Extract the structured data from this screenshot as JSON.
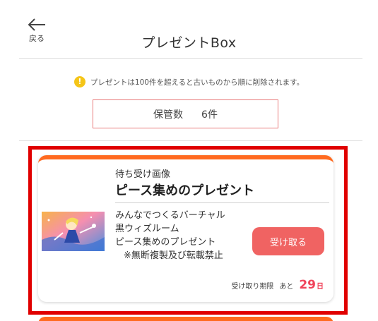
{
  "header": {
    "back_label": "戻る",
    "title": "プレゼントBox"
  },
  "notice": {
    "icon": "exclamation-warning-icon",
    "text": "プレゼントは100件を超えると古いものから順に削除されます。"
  },
  "storage": {
    "label": "保管数",
    "count": "6件"
  },
  "present_card": {
    "category": "待ち受け画像",
    "title": "ピース集めのプレゼント",
    "description": [
      "みんなでつくるバーチャル",
      "黒ウィズルーム",
      "ピース集めのプレゼント",
      "※無断複製及び転載禁止"
    ],
    "receive_button": "受け取る",
    "deadline_label": "受け取り期限",
    "remaining_prefix": "あと",
    "remaining_days": "29",
    "remaining_unit": "日"
  },
  "colors": {
    "accent_orange": "#ff6a1f",
    "button_red": "#f06362",
    "days_red": "#f0435a",
    "highlight_red": "#e00000",
    "warning_yellow": "#f5c518"
  }
}
